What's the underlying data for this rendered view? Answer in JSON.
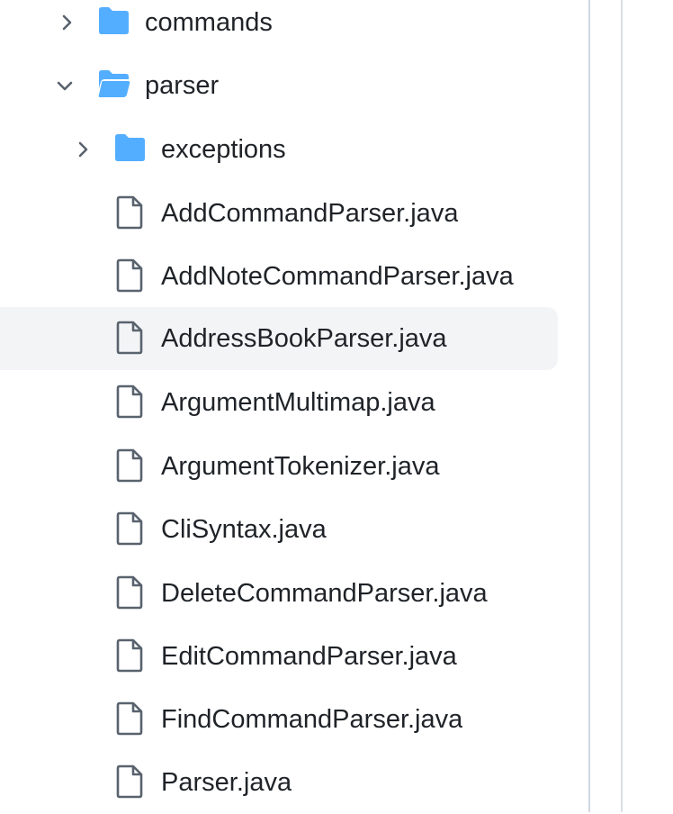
{
  "file_tree": {
    "items": [
      {
        "type": "folder",
        "name": "commands",
        "state": "collapsed",
        "depth": 0
      },
      {
        "type": "folder",
        "name": "parser",
        "state": "expanded",
        "depth": 0
      },
      {
        "type": "folder",
        "name": "exceptions",
        "state": "collapsed",
        "depth": 1
      },
      {
        "type": "file",
        "name": "AddCommandParser.java",
        "depth": 1
      },
      {
        "type": "file",
        "name": "AddNoteCommandParser.java",
        "depth": 1
      },
      {
        "type": "file",
        "name": "AddressBookParser.java",
        "depth": 1,
        "hovered": true
      },
      {
        "type": "file",
        "name": "ArgumentMultimap.java",
        "depth": 1
      },
      {
        "type": "file",
        "name": "ArgumentTokenizer.java",
        "depth": 1
      },
      {
        "type": "file",
        "name": "CliSyntax.java",
        "depth": 1
      },
      {
        "type": "file",
        "name": "DeleteCommandParser.java",
        "depth": 1
      },
      {
        "type": "file",
        "name": "EditCommandParser.java",
        "depth": 1
      },
      {
        "type": "file",
        "name": "FindCommandParser.java",
        "depth": 1
      },
      {
        "type": "file",
        "name": "Parser.java",
        "depth": 1
      }
    ]
  },
  "colors": {
    "folder": "#54aeff",
    "file_icon": "#59636e",
    "chevron": "#59636e",
    "text": "#1f2328",
    "hover_bg": "#f3f4f6"
  },
  "icons": {
    "collapsed": "chevron-right-icon",
    "expanded": "chevron-down-icon",
    "folder": "folder-icon",
    "folder_open": "folder-open-icon",
    "file": "file-icon"
  }
}
